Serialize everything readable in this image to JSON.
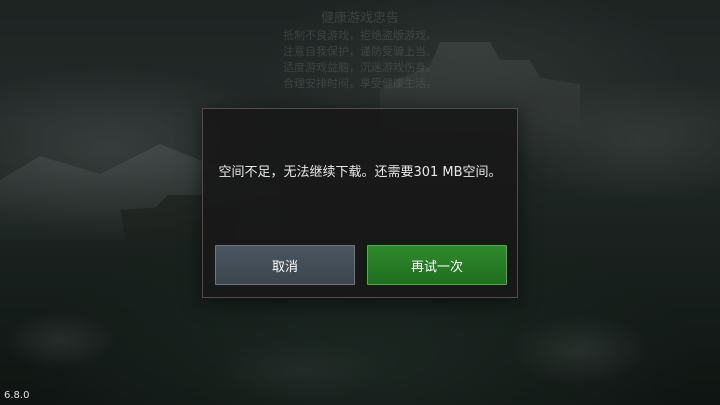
{
  "background_notice": {
    "title": "健康游戏忠告",
    "lines": [
      "抵制不良游戏，拒绝盗版游戏。",
      "注意自我保护，谨防受骗上当。",
      "适度游戏益脑，沉迷游戏伤身。",
      "合理安排时间，享受健康生活。"
    ]
  },
  "dialog": {
    "message": "空间不足，无法继续下载。还需要301 MB空间。",
    "cancel_label": "取消",
    "retry_label": "再试一次"
  },
  "version": "6.8.0",
  "colors": {
    "dialog_bg": "#181818",
    "cancel_button": "#434d57",
    "retry_button": "#267b24"
  }
}
